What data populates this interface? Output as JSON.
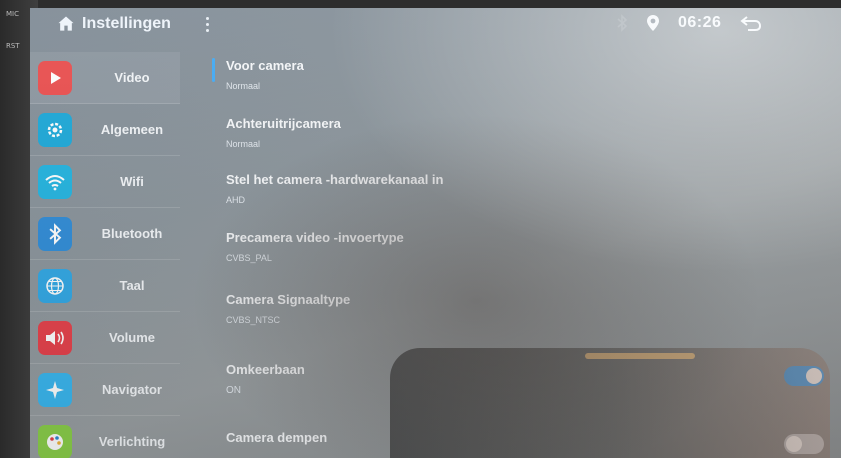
{
  "header": {
    "title": "Instellingen",
    "time": "06:26"
  },
  "sidebar": {
    "items": [
      {
        "label": "Video",
        "icon": "play-icon",
        "color": "#ea4b4b"
      },
      {
        "label": "Algemeen",
        "icon": "gear-icon",
        "color": "#18a7d8"
      },
      {
        "label": "Wifi",
        "icon": "wifi-icon",
        "color": "#1fb3e0"
      },
      {
        "label": "Bluetooth",
        "icon": "bluetooth-icon",
        "color": "#2d8bd7"
      },
      {
        "label": "Taal",
        "icon": "globe-icon",
        "color": "#2fa7e5"
      },
      {
        "label": "Volume",
        "icon": "speaker-icon",
        "color": "#e6404a"
      },
      {
        "label": "Navigator",
        "icon": "compass-icon",
        "color": "#39b7f0"
      },
      {
        "label": "Verlichting",
        "icon": "palette-icon",
        "color": "#8bd04a"
      }
    ]
  },
  "settings": [
    {
      "title": "Voor camera",
      "value": "Normaal"
    },
    {
      "title": "Achteruitrijcamera",
      "value": "Normaal"
    },
    {
      "title": "Stel het camera -hardwarekanaal in",
      "value": "AHD"
    },
    {
      "title": "Precamera video -invoertype",
      "value": "CVBS_PAL"
    },
    {
      "title": "Camera Signaaltype",
      "value": "CVBS_NTSC"
    },
    {
      "title": "Omkeerbaan",
      "value": "ON",
      "toggle": true
    },
    {
      "title": "Camera dempen",
      "toggle": false
    }
  ],
  "colors": {
    "accent": "#3fa9f5",
    "toggle_on": "#4aa6ef",
    "toggle_off": "#c8ccd0"
  }
}
